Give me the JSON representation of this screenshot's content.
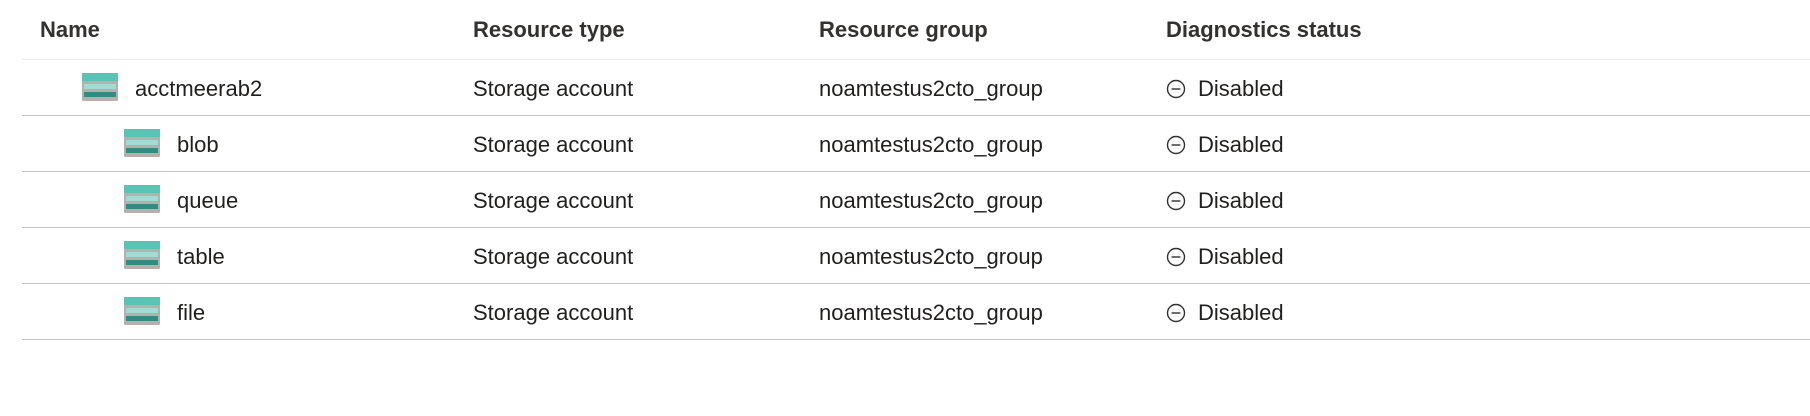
{
  "columns": {
    "name": "Name",
    "resource_type": "Resource type",
    "resource_group": "Resource group",
    "diagnostics_status": "Diagnostics status"
  },
  "rows": [
    {
      "name": "acctmeerab2",
      "resource_type": "Storage account",
      "resource_group": "noamtestus2cto_group",
      "status": "Disabled",
      "icon": "storage-account-icon",
      "indent_level": 0
    },
    {
      "name": "blob",
      "resource_type": "Storage account",
      "resource_group": "noamtestus2cto_group",
      "status": "Disabled",
      "icon": "storage-account-icon",
      "indent_level": 1
    },
    {
      "name": "queue",
      "resource_type": "Storage account",
      "resource_group": "noamtestus2cto_group",
      "status": "Disabled",
      "icon": "storage-account-icon",
      "indent_level": 1
    },
    {
      "name": "table",
      "resource_type": "Storage account",
      "resource_group": "noamtestus2cto_group",
      "status": "Disabled",
      "icon": "storage-account-icon",
      "indent_level": 1
    },
    {
      "name": "file",
      "resource_type": "Storage account",
      "resource_group": "noamtestus2cto_group",
      "status": "Disabled",
      "icon": "storage-account-icon",
      "indent_level": 1
    }
  ],
  "status_icon": "disabled-circle-minus-icon",
  "colors": {
    "icon_teal": "#5cc2b5",
    "icon_dark_teal": "#2f8e84",
    "icon_gray": "#a19f9d",
    "divider": "#c8c6c4"
  }
}
